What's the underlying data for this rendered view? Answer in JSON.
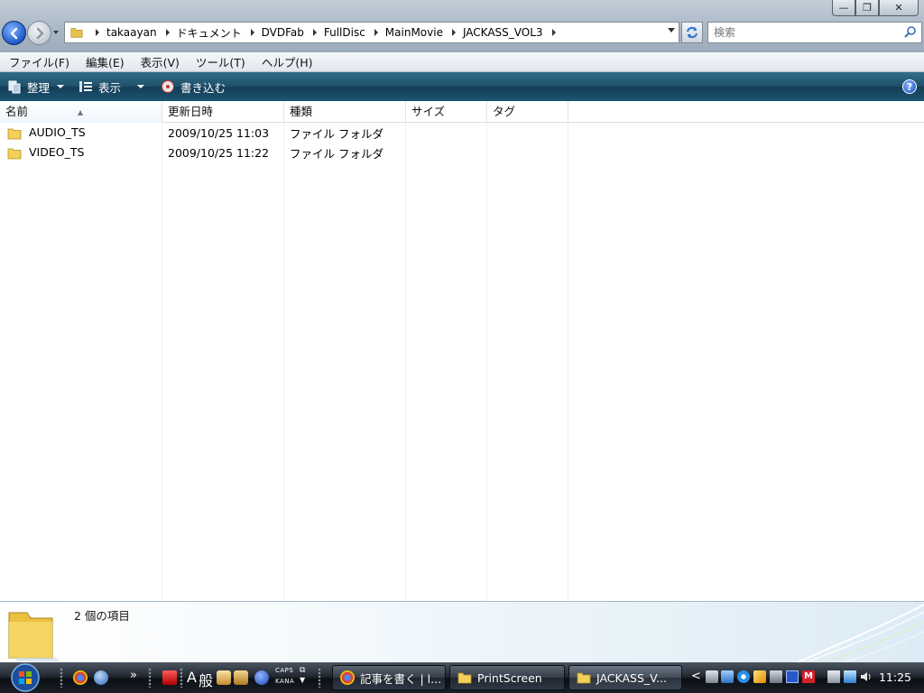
{
  "window": {
    "buttons": {
      "minimize": "—",
      "maximize": "❐",
      "close": "✕"
    }
  },
  "address": {
    "crumbs": [
      "takaayan",
      "ドキュメント",
      "DVDFab",
      "FullDisc",
      "MainMovie",
      "JACKASS_VOL3"
    ]
  },
  "search": {
    "placeholder": "検索"
  },
  "menu": [
    "ファイル(F)",
    "編集(E)",
    "表示(V)",
    "ツール(T)",
    "ヘルプ(H)"
  ],
  "commands": {
    "organize": "整理",
    "views": "表示",
    "burn": "書き込む",
    "help": "?"
  },
  "columns": {
    "name": "名前",
    "modified": "更新日時",
    "type": "種類",
    "size": "サイズ",
    "tags": "タグ"
  },
  "files": [
    {
      "name": "AUDIO_TS",
      "modified": "2009/10/25 11:03",
      "type": "ファイル フォルダ",
      "size": "",
      "tags": ""
    },
    {
      "name": "VIDEO_TS",
      "modified": "2009/10/25 11:22",
      "type": "ファイル フォルダ",
      "size": "",
      "tags": ""
    }
  ],
  "details": {
    "count": "2 個の項目"
  },
  "taskbar": {
    "chevron": "»",
    "ime_mode": "A",
    "ime_kanji": "般",
    "caps": "CAPS",
    "kana": "KANA",
    "tasks": [
      {
        "label": "記事を書く | l...",
        "icon": "chrome-icon"
      },
      {
        "label": "PrintScreen",
        "icon": "folder-icon"
      },
      {
        "label": "JACKASS_V...",
        "icon": "folder-icon"
      }
    ],
    "tray_chevron": "<",
    "clock": "11:25"
  },
  "colors": {
    "cmdbar": "#1e4f6a",
    "taskbar": "#1b2028",
    "selected_header": "#eef5fb"
  }
}
